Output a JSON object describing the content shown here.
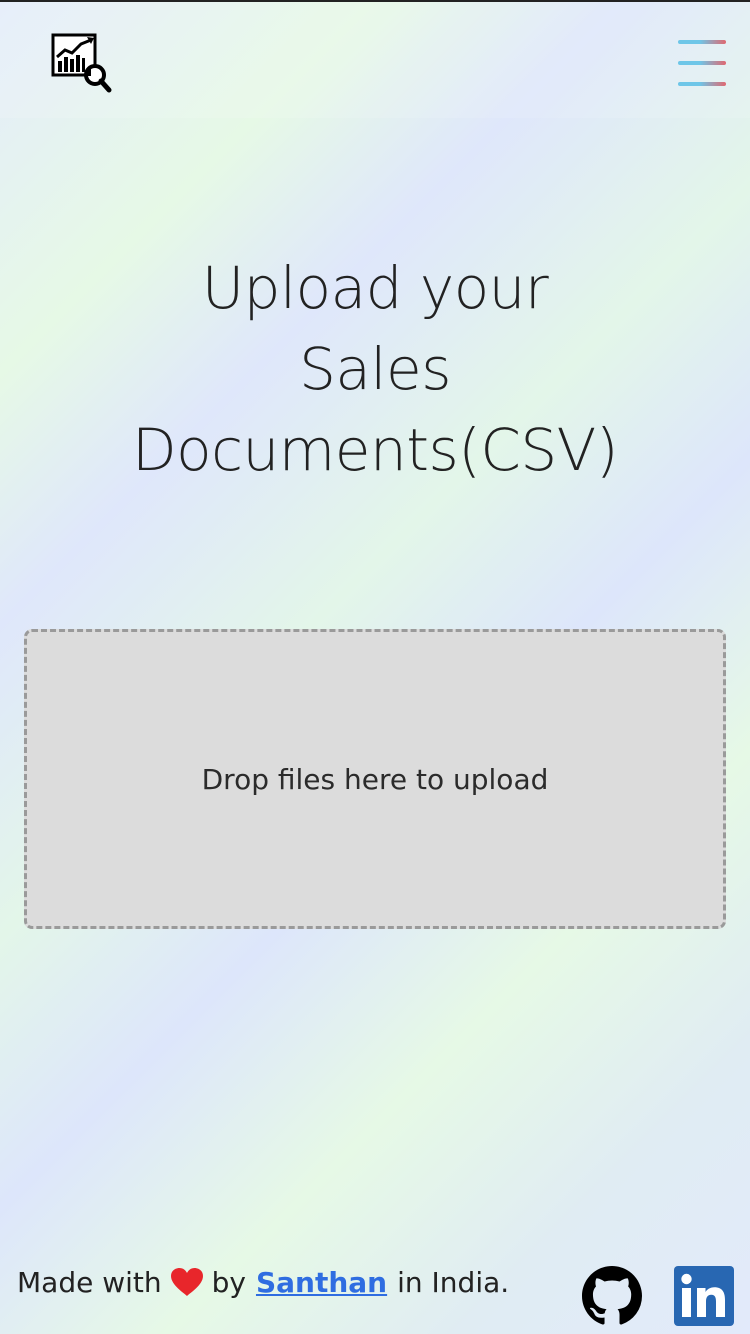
{
  "navbar": {
    "logo_icon": "sales-analytics-logo-icon",
    "menu_icon": "hamburger-menu-icon"
  },
  "hero": {
    "title_lines": [
      "Upload your",
      "Sales",
      "Documents(CSV)"
    ]
  },
  "upload": {
    "dropzone_text": "Drop files here to upload"
  },
  "footer": {
    "made_with": "Made with",
    "by": "by",
    "author": "Santhan",
    "location": "in India.",
    "heart_icon": "heart-icon",
    "github_icon": "github-icon",
    "linkedin_icon": "linkedin-icon"
  },
  "colors": {
    "link": "#2f6de1",
    "heart": "#e8262b",
    "linkedin": "#2867b2",
    "dropzone_bg": "#dcdcdc",
    "dropzone_border": "#9a9a9a"
  }
}
